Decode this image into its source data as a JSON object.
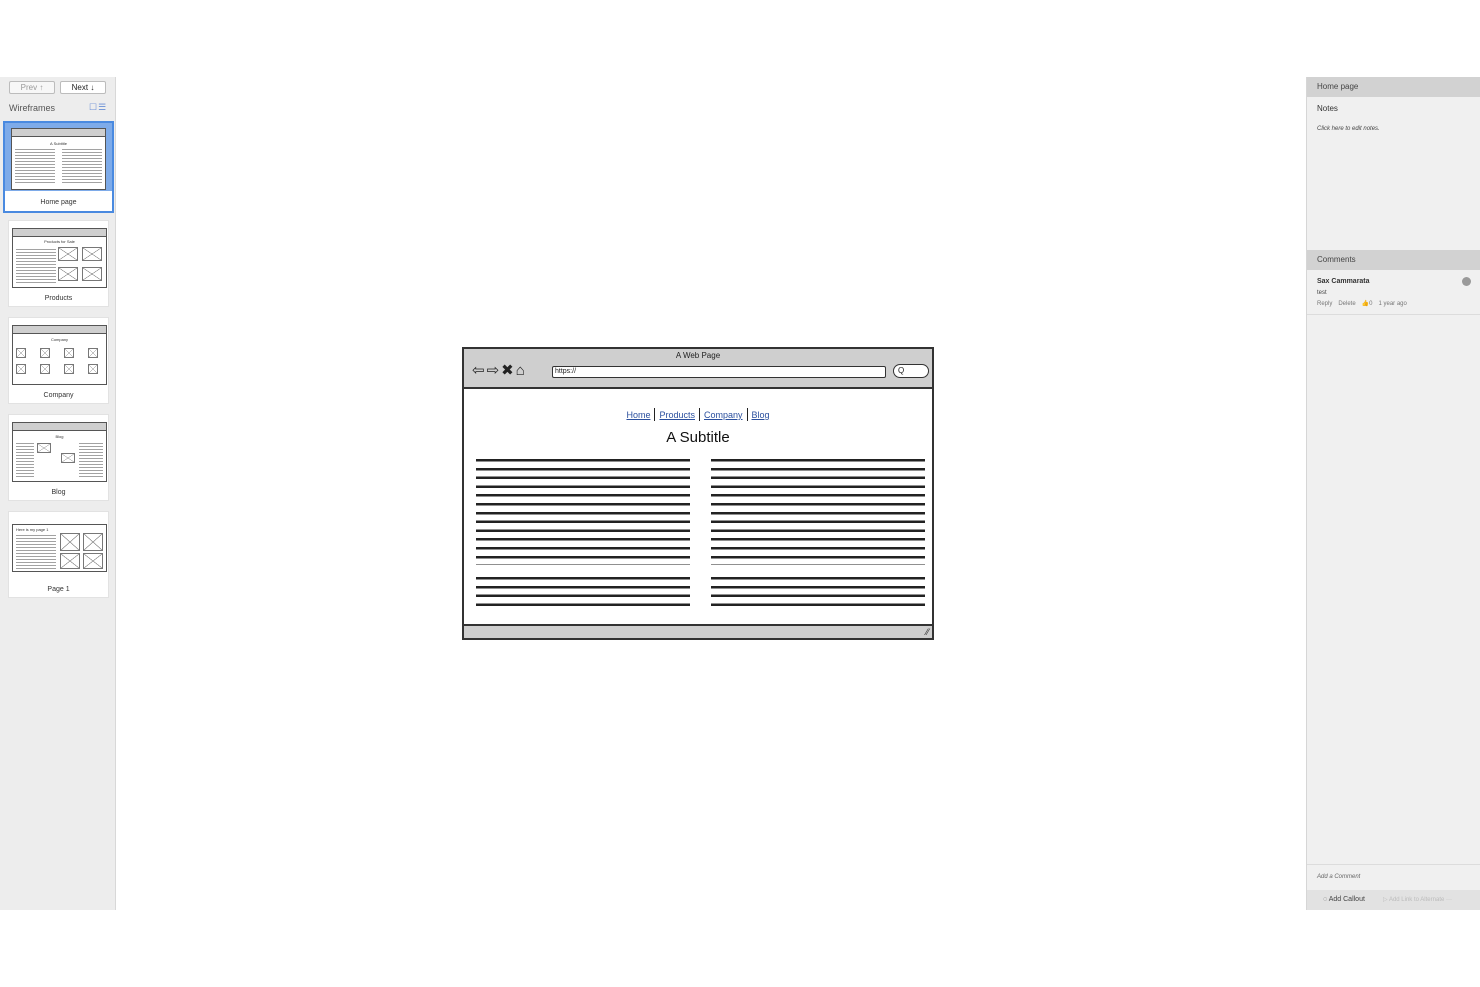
{
  "sidebar": {
    "prev_label": "Prev ↑",
    "next_label": "Next ↓",
    "title": "Wireframes",
    "view_icons": "☐☰",
    "pages": [
      {
        "name": "Home page",
        "mini_title": "A Subtitle"
      },
      {
        "name": "Products",
        "mini_title": "Products for Sale"
      },
      {
        "name": "Company",
        "mini_title": "Company"
      },
      {
        "name": "Blog",
        "mini_title": "Blog"
      },
      {
        "name": "Page 1",
        "mini_title": "Here is my page 1"
      }
    ]
  },
  "wireframe": {
    "window_title": "A Web Page",
    "nav_icons": "⇦⇨✖⌂",
    "url": "https://",
    "search_icon": "Q",
    "links": [
      "Home",
      "Products",
      "Company",
      "Blog"
    ],
    "subtitle": "A Subtitle",
    "resize_grip": "⁄⁄"
  },
  "panel": {
    "page_name": "Home page",
    "notes_label": "Notes",
    "notes_placeholder": "Click here to edit notes.",
    "comments_label": "Comments",
    "comment": {
      "author": "Sax Cammarata",
      "text": "test",
      "reply": "Reply",
      "delete": "Delete",
      "likes": "👍0",
      "time": "1 year ago"
    },
    "add_comment": "Add a Comment",
    "add_callout": "◌ Add Callout",
    "add_link": "▷ Add Link to Alternate ···"
  }
}
